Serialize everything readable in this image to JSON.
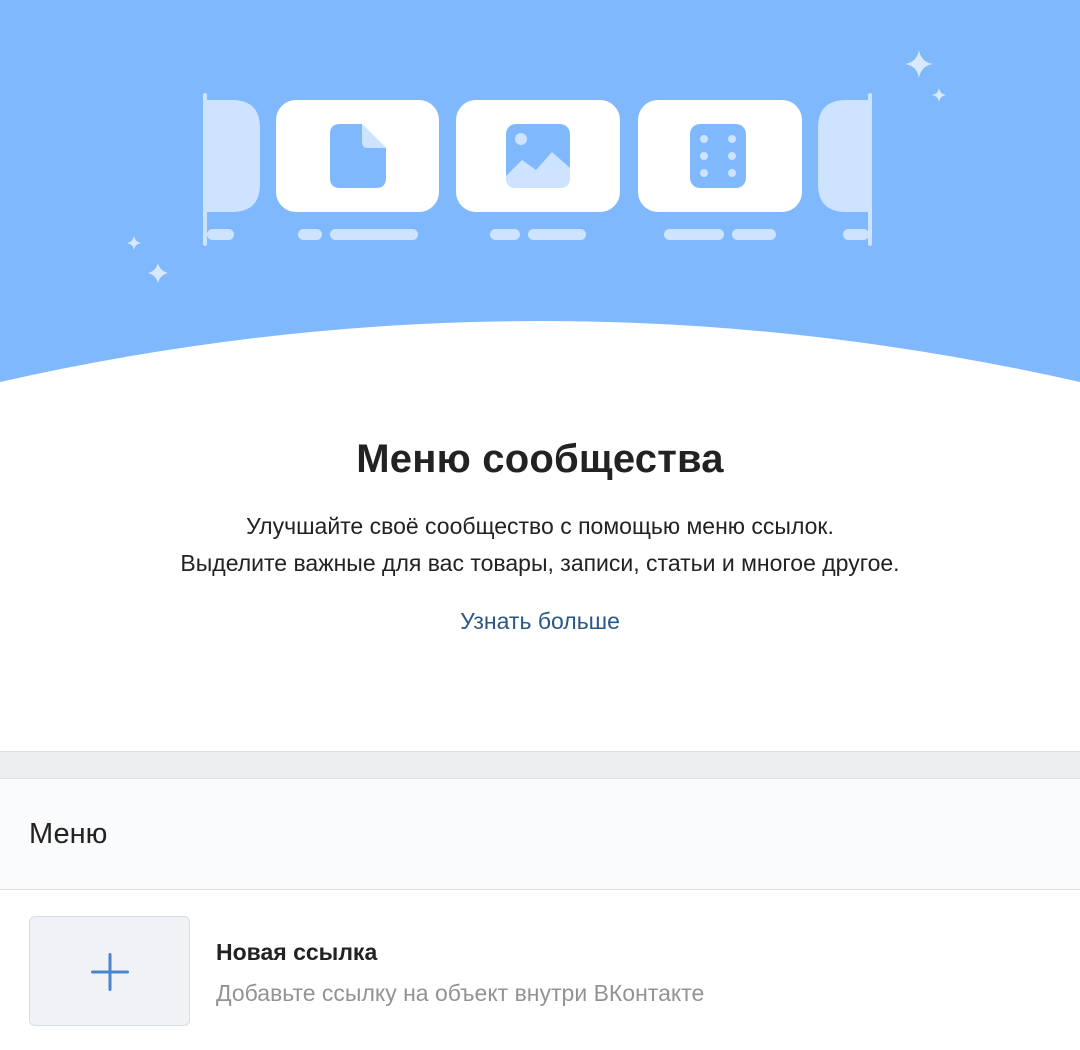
{
  "hero": {
    "illustration_icons": [
      "document-icon",
      "image-icon",
      "dice-icon",
      "sparkle-icon"
    ],
    "colors": {
      "background": "#80b8fe",
      "card": "#ffffff",
      "card_faded": "#cde3ff",
      "accent": "#80b8fe"
    }
  },
  "intro": {
    "title": "Меню сообщества",
    "description_line1": "Улучшайте своё сообщество с помощью меню ссылок.",
    "description_line2": "Выделите важные для вас товары, записи, статьи и многое другое.",
    "learn_more": "Узнать больше",
    "link_color": "#2a5885"
  },
  "menu": {
    "header": "Меню",
    "new_link": {
      "icon": "plus-icon",
      "title": "Новая ссылка",
      "subtitle": "Добавьте ссылку на объект внутри ВКонтакте"
    }
  }
}
